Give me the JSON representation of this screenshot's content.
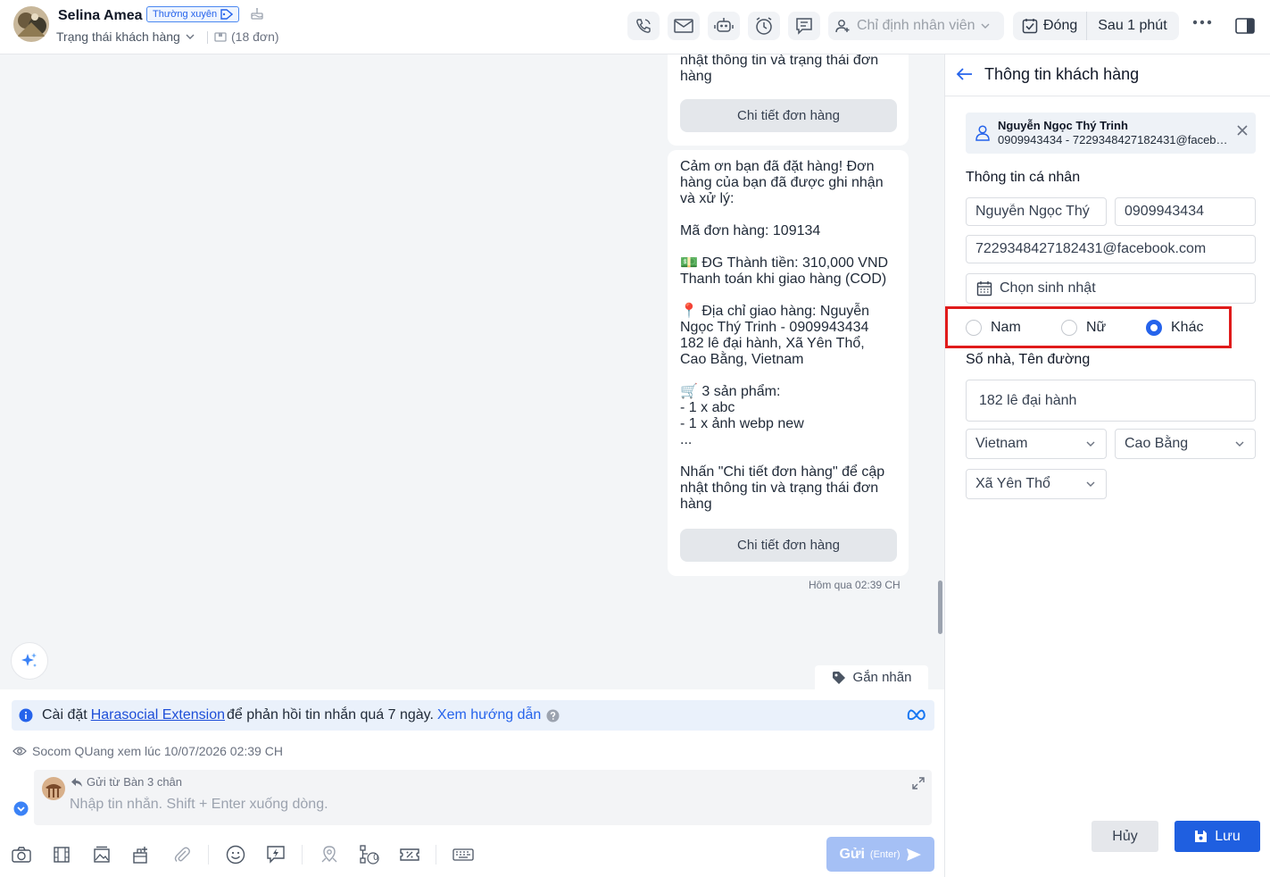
{
  "header": {
    "customer_name": "Selina Amea",
    "tag": "Thường xuyên",
    "status_label": "Trạng thái khách hàng",
    "order_count": "(18 đơn)",
    "assign_placeholder": "Chỉ định nhân viên",
    "close_label": "Đóng",
    "snooze_label": "Sau 1 phút"
  },
  "chat": {
    "bubble1_text": "nhật thông tin và trạng thái đơn\nhàng",
    "bubble2_text": "Cảm ơn bạn đã đặt hàng! Đơn\nhàng của bạn đã được ghi nhận\nvà xử lý:\n\nMã đơn hàng: 109134\n\n💵 ĐG Thành tiền: 310,000 VND\nThanh toán khi giao hàng (COD)\n\n📍 Địa chỉ giao hàng: Nguyễn\nNgọc Thý Trinh - 0909943434\n182 lê đại hành, Xã Yên Thổ,\nCao Bằng, Vietnam\n\n🛒 3 sản phẩm:\n- 1 x abc\n- 1 x ảnh webp new\n...\n\nNhấn \"Chi tiết đơn hàng\" để cập\nnhật thông tin và trạng thái đơn\nhàng",
    "order_detail_button": "Chi tiết đơn hàng",
    "timestamp": "Hôm qua 02:39 CH",
    "label_button": "Gắn nhãn"
  },
  "infobar": {
    "prefix": "Cài đặt",
    "extension_link": "Harasocial Extension",
    "middle": "để phản hồi tin nhắn quá 7 ngày.",
    "guide_link": "Xem hướng dẫn"
  },
  "seen_text": "Socom QUang xem lúc 10/07/2026 02:39 CH",
  "composer": {
    "sent_from": "Gửi từ Bàn 3 chân",
    "placeholder": "Nhập tin nhắn. Shift + Enter xuống dòng.",
    "send_label": "Gửi",
    "send_hint": "(Enter)",
    "queue_count": "0"
  },
  "panel": {
    "title": "Thông tin khách hàng",
    "card_name": "Nguyễn Ngọc Thý Trinh",
    "card_sub": "0909943434 - 7229348427182431@facebook.com",
    "personal_title": "Thông tin cá nhân",
    "name_value": "Nguyễn Ngọc Thý",
    "phone_value": "0909943434",
    "email_value": "7229348427182431@facebook.com",
    "birthday_placeholder": "Chọn sinh nhật",
    "gender_options": [
      "Nam",
      "Nữ",
      "Khác"
    ],
    "gender_selected": "Khác",
    "address_title": "Số nhà, Tên đường",
    "address_value": "182 lê đại hành",
    "country": "Vietnam",
    "province": "Cao Bằng",
    "ward": "Xã Yên Thổ",
    "cancel_label": "Hủy",
    "save_label": "Lưu"
  },
  "colors": {
    "accent": "#2563eb",
    "highlight": "#e01b1b",
    "save_button": "#1f5fe0",
    "send_button": "#a5c0f5"
  }
}
